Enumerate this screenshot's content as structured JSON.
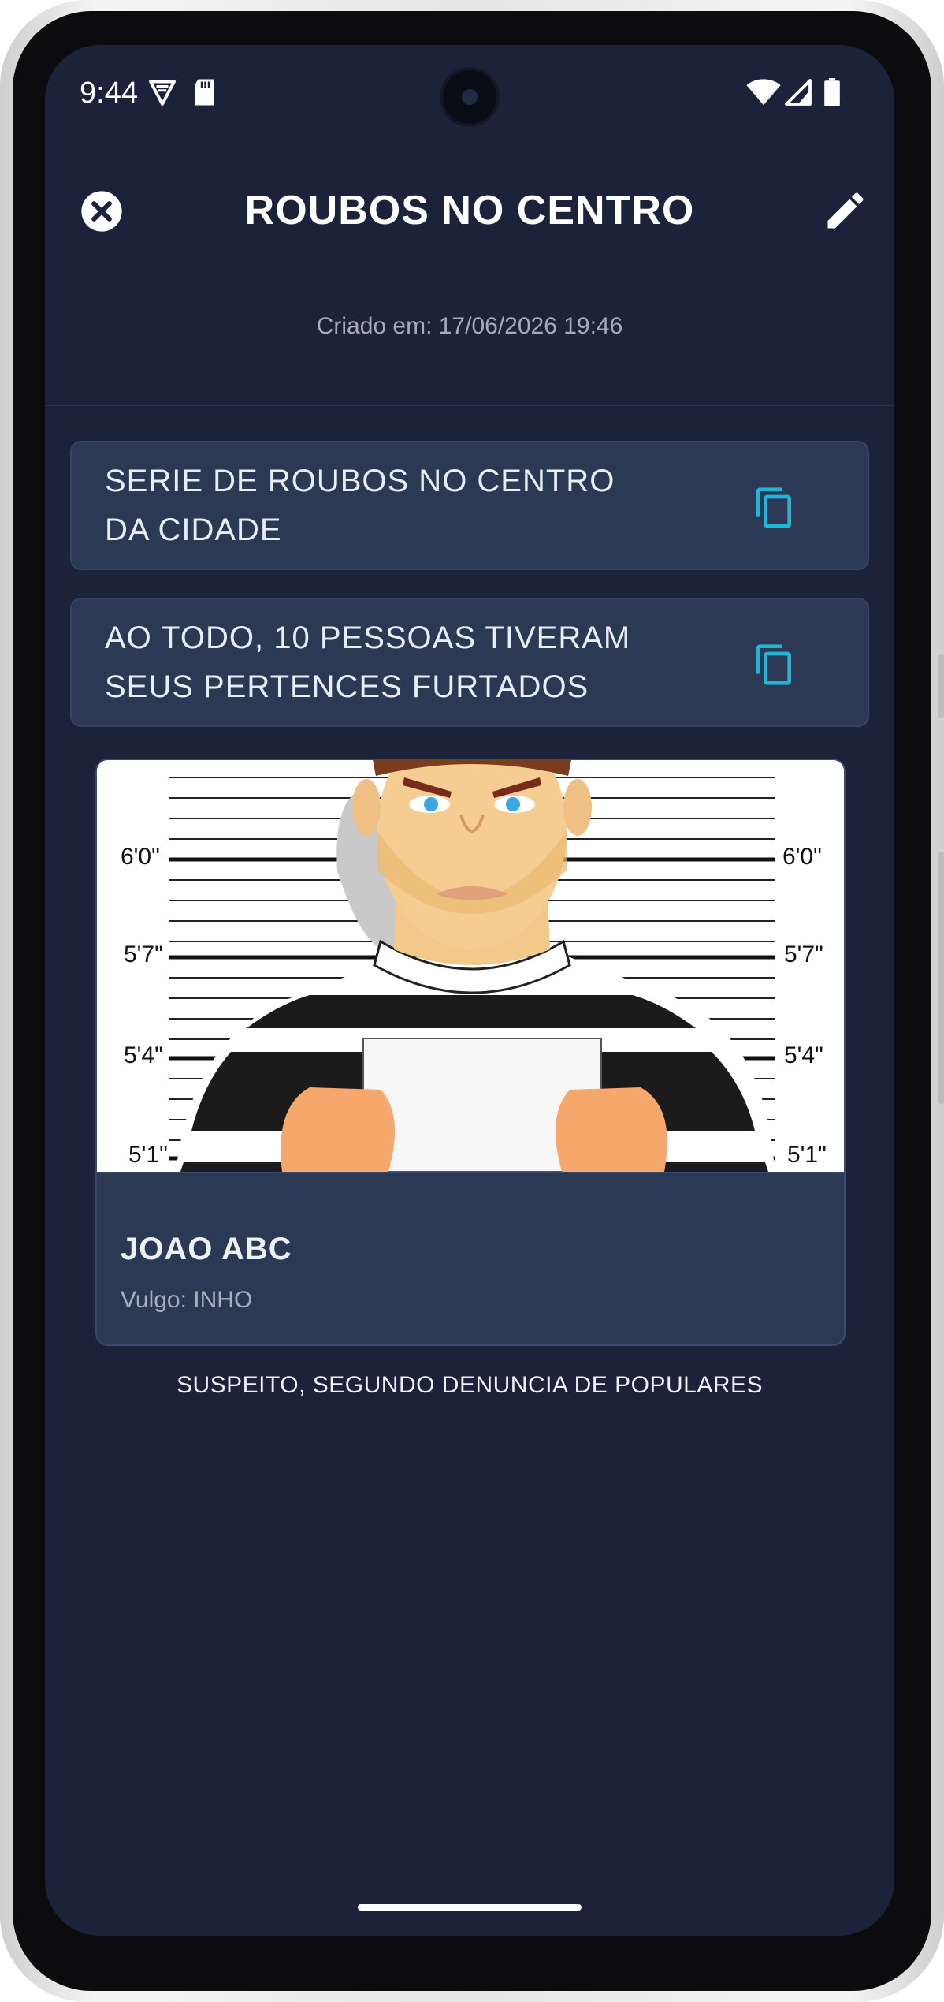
{
  "status_bar": {
    "time": "9:44",
    "left_icons": [
      "vpn-shield-icon",
      "sd-card-icon"
    ],
    "right_icons": [
      "wifi-icon",
      "cell-signal-icon",
      "battery-icon"
    ]
  },
  "app_bar": {
    "title": "ROUBOS NO CENTRO",
    "close_icon": "close-circle-icon",
    "edit_icon": "pencil-icon"
  },
  "created_label": "Criado em: 17/06/2026 19:46",
  "notes": [
    {
      "text": "SERIE DE ROUBOS NO CENTRO DA CIDADE",
      "action_icon": "copy-icon"
    },
    {
      "text": "AO TODO, 10 PESSOAS TIVERAM SEUS PERTENCES FURTADOS",
      "action_icon": "copy-icon"
    }
  ],
  "person": {
    "name": "JOAO ABC",
    "alias": "Vulgo: INHO",
    "photo": {
      "height_marks_left": [
        "6'0\"",
        "5'7\"",
        "5'4\"",
        "5'1\""
      ],
      "height_marks_right": [
        "6'0\"",
        "5'7\"",
        "5'4\"",
        "5'1\""
      ]
    }
  },
  "caption": "SUSPEITO, SEGUNDO DENUNCIA DE POPULARES",
  "colors": {
    "background": "#1c2239",
    "card": "#2b3955",
    "accent_copy": "#1fb6d8",
    "text": "#ffffff",
    "muted_text": "#a5abbb"
  }
}
